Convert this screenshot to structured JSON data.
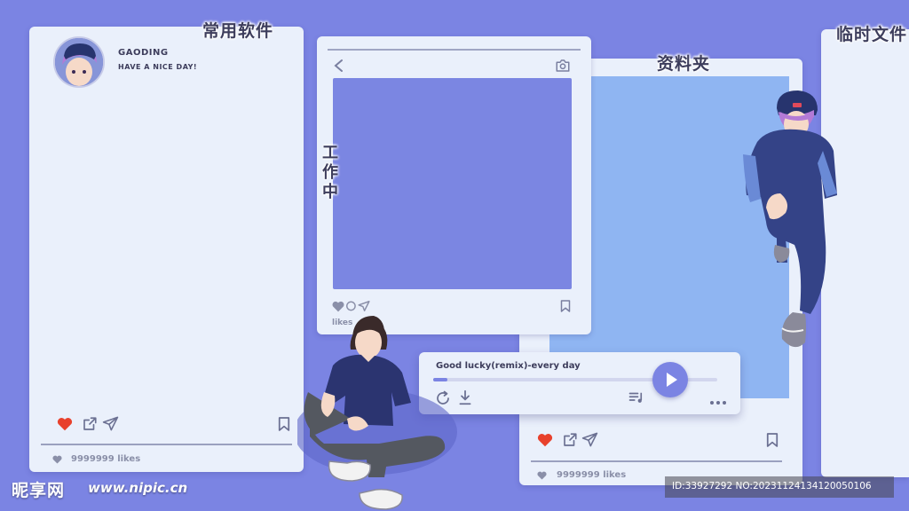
{
  "left_panel": {
    "title": "常用软件",
    "username": "GAODING",
    "status": "HAVE A NICE DAY!",
    "likes": "9999999 likes",
    "icons": [
      "heart-icon",
      "share-icon",
      "send-icon",
      "bookmark-icon"
    ]
  },
  "middle_panel": {
    "side_label": "工\n作\n中",
    "likes": "likes",
    "icons": [
      "back-icon",
      "camera-icon",
      "heart-icon",
      "comment-icon",
      "send-icon",
      "bookmark-icon"
    ]
  },
  "music_player": {
    "song": "Good lucky(remix)-every day",
    "progress": 0.05,
    "icons": [
      "repeat-icon",
      "download-icon",
      "playlist-icon",
      "play-icon",
      "more-icon"
    ]
  },
  "folder_panel": {
    "title": "资料夹",
    "likes": "9999999 likes",
    "icons": [
      "heart-icon",
      "share-icon",
      "send-icon",
      "bookmark-icon"
    ]
  },
  "right_panel": {
    "title": "临时文件"
  },
  "watermark": {
    "logo": "昵享网",
    "url": "www.nipic.cn",
    "id_text": "ID:33927292 NO:20231124134120050106"
  },
  "colors": {
    "background": "#7b84e3",
    "panel": "#eaf0fb",
    "photo": "#7b86e2",
    "folder_photo": "#8fb5f2",
    "heart": "#e8412c",
    "accent": "#7b84e3"
  }
}
